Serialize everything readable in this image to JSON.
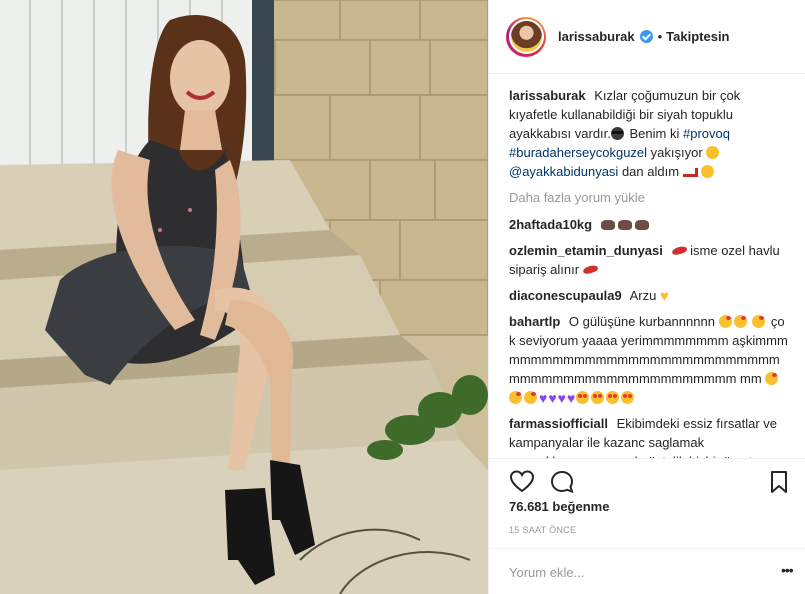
{
  "post": {
    "username": "larissaburak",
    "follow_status": "Takiptesin",
    "dot": "•",
    "caption": {
      "user": "larissaburak",
      "text_1": "Kızlar çoğumuzun bir çok kıyafetle kullanabildiği bir siyah topuklu ayakkabısı vardır.",
      "text_2": " Benim ki ",
      "tag_1": "#provoq",
      "tag_2": "#buradaherseycokguzel",
      "text_3": " yakışıyor ",
      "mention": "@ayakkabidunyasi",
      "text_4": " dan aldım "
    },
    "load_more": "Daha fazla yorum yükle",
    "comments": [
      {
        "user": "2haftada10kg",
        "text": ""
      },
      {
        "user": "ozlemin_etamin_dunyasi",
        "text": "isme ozel havlu sipariş alınır"
      },
      {
        "user": "diaconescupaula9",
        "text": "Arzu"
      },
      {
        "user": "bahar‌tlp",
        "text_1": "O gülüşüne kurbannnnnn",
        "text_2": "çok seviyorum yaaaa yerimmmmmmmm aşkimmmmmmmmmmmmmmmmmmmmmmmmmmmmmmmmmmmmmmmmmmmmmmmmm mm"
      },
      {
        "user": "farmassiofficiall",
        "text": "Ekibimdeki essiz fırsatlar ve kampanyalar ile kazanc saglamak parmaklarınızın ucunda üstelik hicbir ücret"
      }
    ],
    "likes": "76.681 beğenme",
    "time_ago": "15 SAAT ÖNCE",
    "comment_placeholder": "Yorum ekle...",
    "more_options": "•••"
  },
  "icons": {
    "like": "heart-outline",
    "comment": "speech-bubble-outline",
    "save": "bookmark-outline",
    "verified": "blue-check-badge"
  },
  "colors": {
    "text": "#262626",
    "muted": "#999999",
    "link": "#003569",
    "verified": "#3897f0",
    "border": "#efefef"
  }
}
